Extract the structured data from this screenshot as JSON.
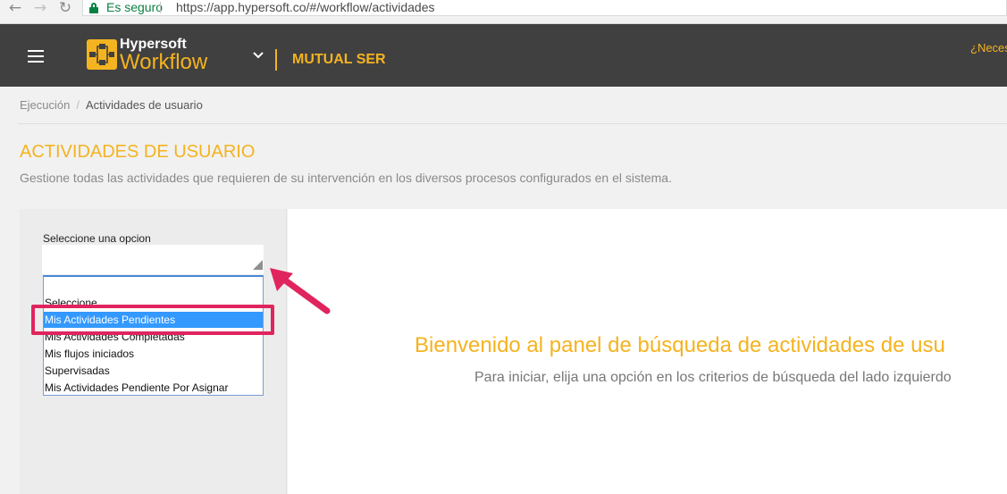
{
  "browser": {
    "secure_label": "Es seguro",
    "url": "https://app.hypersoft.co/#/workflow/actividades"
  },
  "header": {
    "brand_top": "Hypersoft",
    "brand_bottom": "Workflow",
    "organization": "MUTUAL SER",
    "help_text": "¿Neces"
  },
  "breadcrumb": {
    "items": [
      "Ejecución",
      "Actividades de usuario"
    ]
  },
  "page": {
    "title": "ACTIVIDADES DE USUARIO",
    "description": "Gestione todas las actividades que requieren de su intervención en los diversos procesos configurados en el sistema."
  },
  "filter": {
    "label": "Seleccione una opcion",
    "options": [
      "Seleccione",
      "Mis Actividades Pendientes",
      "Mis Actividades Completadas",
      "Mis flujos iniciados",
      "Supervisadas",
      "Mis Actividades Pendiente Por Asignar"
    ],
    "highlighted_option": "Mis Actividades Pendientes"
  },
  "main": {
    "welcome_title": "Bienvenido al panel de búsqueda de actividades de usu",
    "welcome_subtitle": "Para iniciar, elija una opción en los criterios de búsqueda del lado izquierdo"
  },
  "colors": {
    "accent": "#f4b320",
    "header_bg": "#404040",
    "annotation": "#e0245e",
    "selection": "#3399ff"
  }
}
